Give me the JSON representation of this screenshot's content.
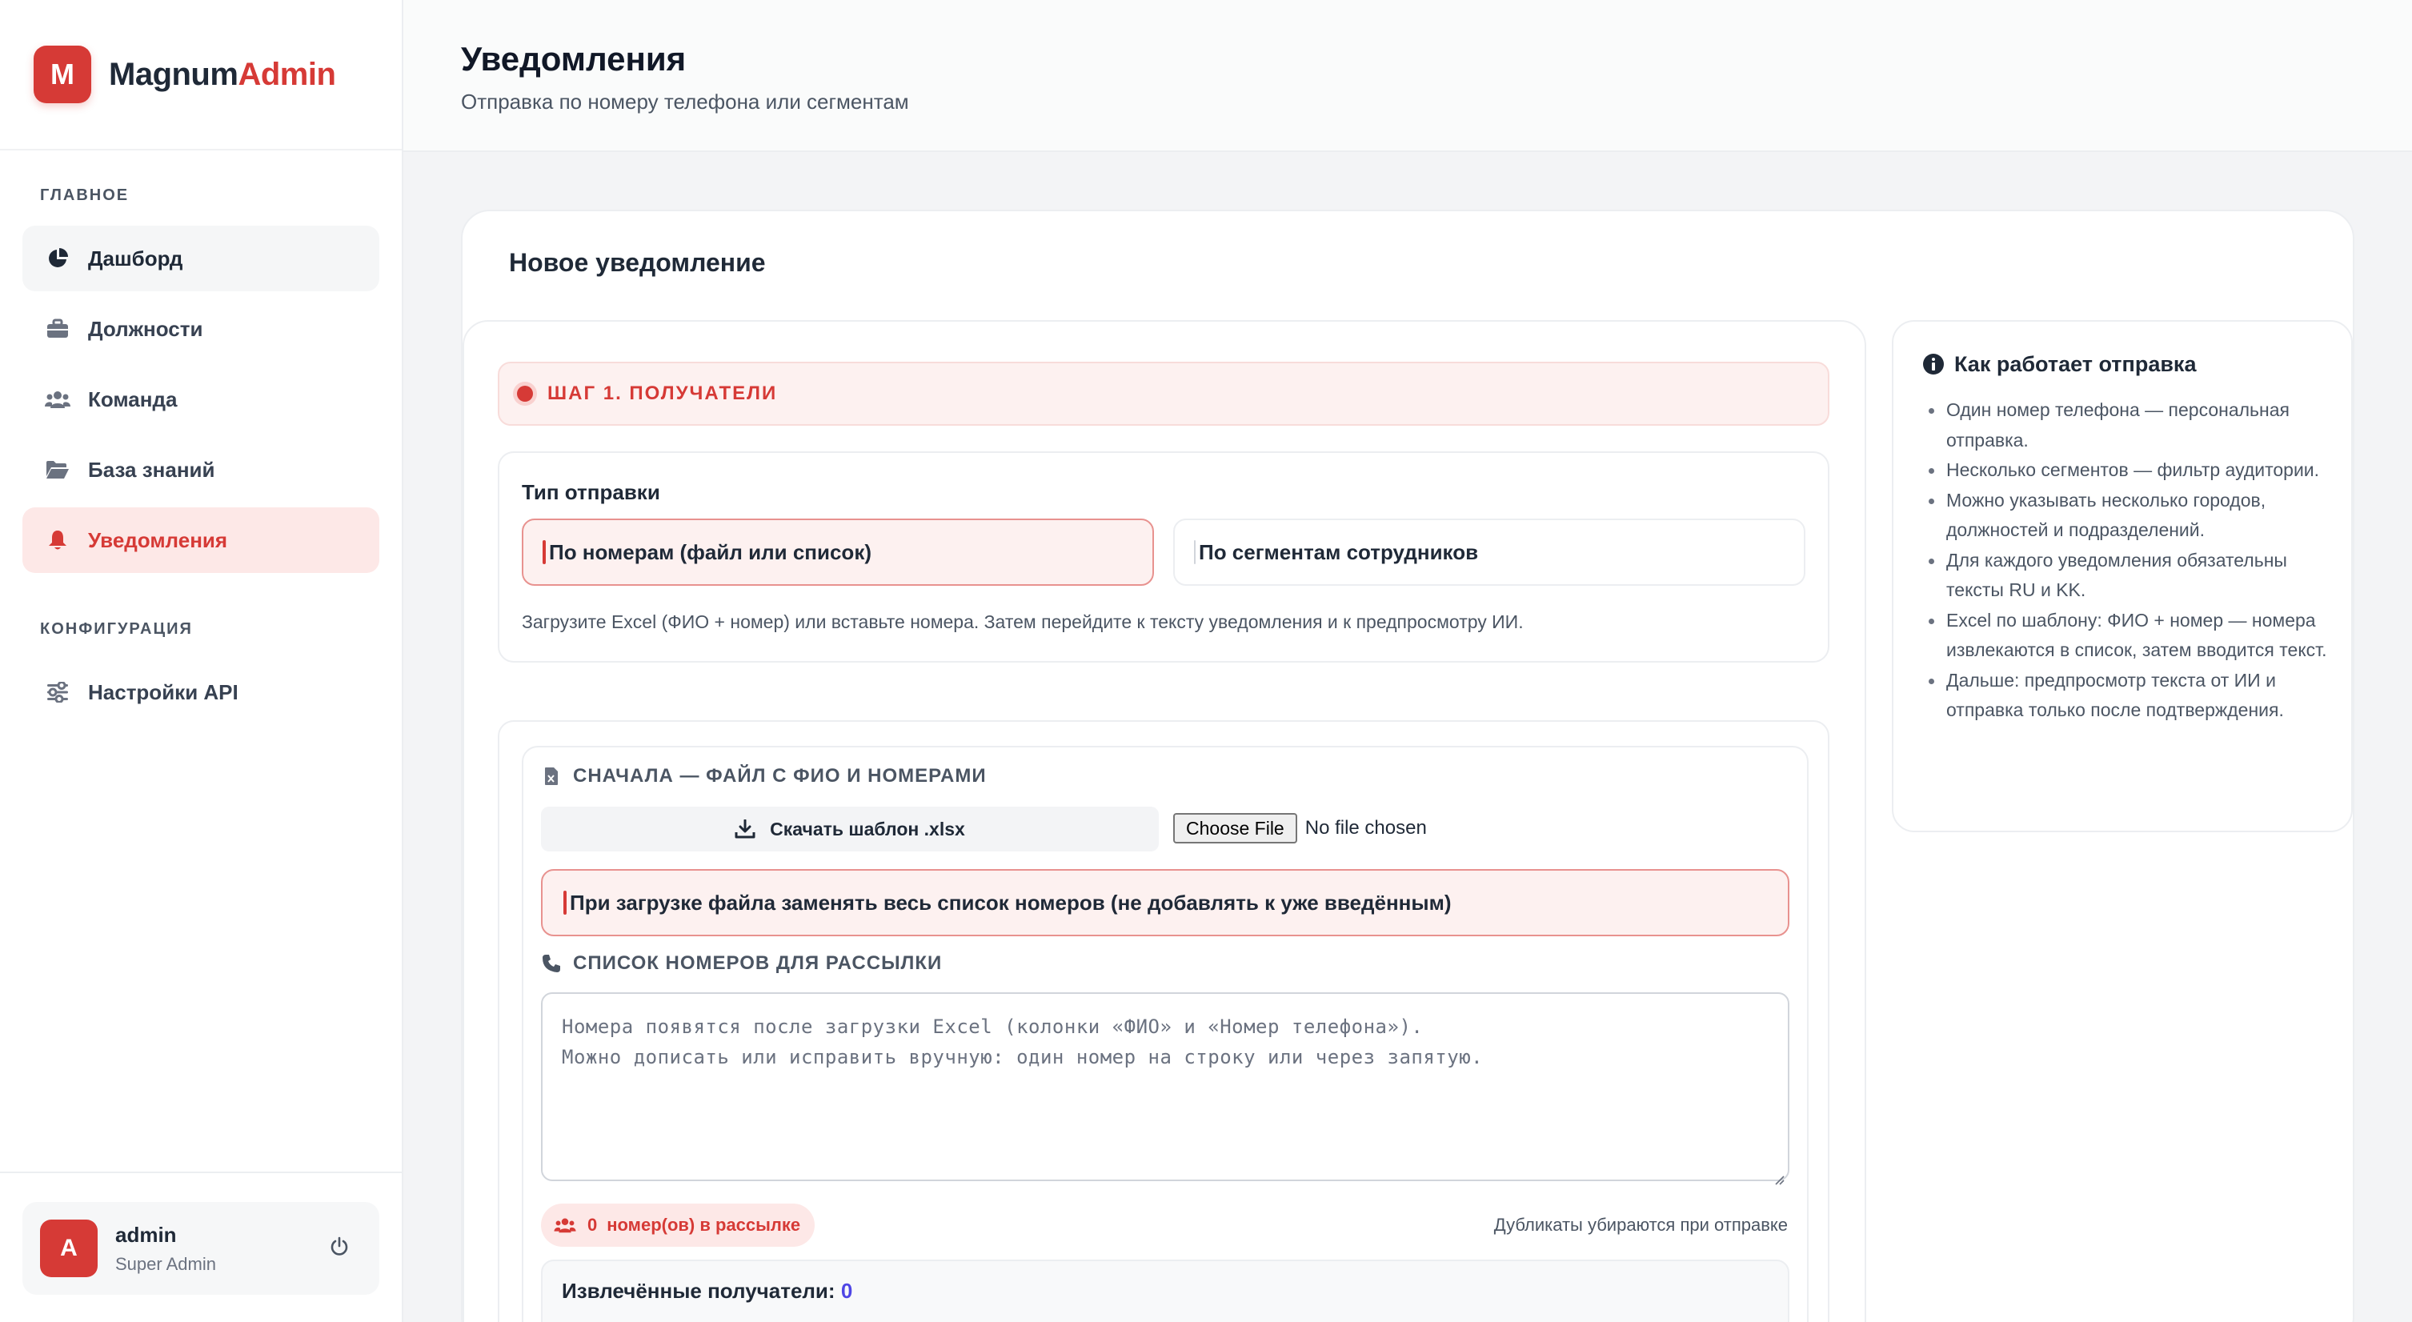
{
  "brand": {
    "logo_letter": "M",
    "name_part1": "Magnum",
    "name_part2": "Admin",
    "accent_color": "#d63a36"
  },
  "sidebar": {
    "section_main": "ГЛАВНОЕ",
    "section_config": "КОНФИГУРАЦИЯ",
    "items": [
      {
        "label": "Дашборд",
        "icon": "chart-pie-icon"
      },
      {
        "label": "Должности",
        "icon": "briefcase-icon"
      },
      {
        "label": "Команда",
        "icon": "users-icon"
      },
      {
        "label": "База знаний",
        "icon": "folder-open-icon"
      },
      {
        "label": "Уведомления",
        "icon": "bell-icon",
        "active": true
      }
    ],
    "config_items": [
      {
        "label": "Настройки API",
        "icon": "sliders-icon"
      }
    ],
    "user": {
      "avatar_letter": "A",
      "name": "admin",
      "role": "Super Admin"
    }
  },
  "header": {
    "title": "Уведомления",
    "subtitle": "Отправка по номеру телефона или сегментам"
  },
  "card": {
    "title": "Новое уведомление",
    "step_label": "ШАГ 1. ПОЛУЧАТЕЛИ",
    "send_type_label": "Тип отправки",
    "option_numbers": "По номерам (файл или список)",
    "option_segments": "По сегментам сотрудников",
    "type_hint": "Загрузите Excel (ФИО + номер) или вставьте номера. Затем перейдите к тексту уведомления и к предпросмотру ИИ.",
    "file_section_title": "СНАЧАЛА — ФАЙЛ С ФИО И НОМЕРАМИ",
    "download_template": "Скачать шаблон .xlsx",
    "choose_file": "Choose File",
    "no_file": "No file chosen",
    "replace_option": "При загрузке файла заменять весь список номеров (не добавлять к уже введённым)",
    "numbers_section_title": "СПИСОК НОМЕРОВ ДЛЯ РАССЫЛКИ",
    "numbers_placeholder": "Номера появятся после загрузки Excel (колонки «ФИО» и «Номер телефона»).\nМожно дописать или исправить вручную: один номер на строку или через запятую.",
    "count_value": "0",
    "count_label": "номер(ов) в рассылке",
    "duplicates_note": "Дубликаты убираются при отправке",
    "extracted_label": "Извлечённые получатели:",
    "extracted_count": "0"
  },
  "info": {
    "title": "Как работает отправка",
    "items": [
      "Один номер телефона — персональная отправка.",
      "Несколько сегментов — фильтр аудитории.",
      "Можно указывать несколько городов, должностей и подразделений.",
      "Для каждого уведомления обязательны тексты RU и KK.",
      "Excel по шаблону: ФИО + номер — номера извлекаются в список, затем вводится текст.",
      "Дальше: предпросмотр текста от ИИ и отправка только после подтверждения."
    ]
  }
}
